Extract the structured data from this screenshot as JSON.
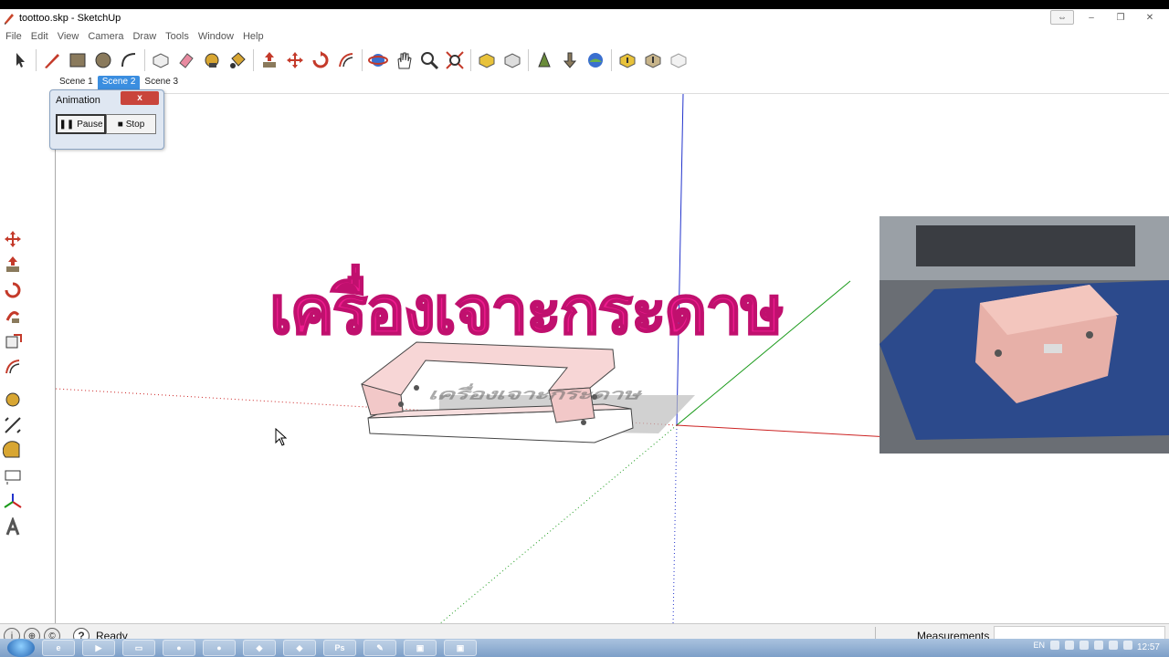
{
  "window": {
    "title": "toottoo.skp - SketchUp",
    "controls": [
      "⇔",
      "–",
      "❐",
      "✕"
    ]
  },
  "menu": [
    "File",
    "Edit",
    "View",
    "Camera",
    "Draw",
    "Tools",
    "Window",
    "Help"
  ],
  "scenes": [
    {
      "label": "Scene 1",
      "active": false
    },
    {
      "label": "Scene 2",
      "active": true
    },
    {
      "label": "Scene 3",
      "active": false
    }
  ],
  "animation_dialog": {
    "title": "Animation",
    "close": "x",
    "pause_label": "Pause",
    "stop_label": "Stop"
  },
  "viewport": {
    "thai_title": "เครื่องเจาะกระดาษ",
    "axis_colors": {
      "red": "#cc2222",
      "green": "#1a9a1a",
      "blue": "#2233cc"
    }
  },
  "status": {
    "text": "Ready",
    "help": "?",
    "measurements_label": "Measurements",
    "measurements_value": ""
  },
  "taskbar": {
    "ps_label": "Ps",
    "tray_lang": "EN",
    "clock": "12:57"
  },
  "colors": {
    "accent": "#3b8ee0",
    "title_pink": "#ee1b8e"
  }
}
